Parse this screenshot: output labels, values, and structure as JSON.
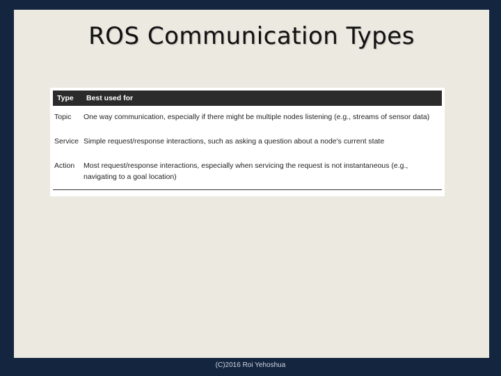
{
  "slide": {
    "title": "ROS Communication Types",
    "footer": "(C)2016 Roi Yehoshua"
  },
  "table": {
    "headers": [
      "Type",
      "Best used for"
    ],
    "rows": [
      {
        "type": "Topic",
        "desc": "One way communication, especially if there might be multiple nodes listening (e.g., streams of sensor data)"
      },
      {
        "type": "Service",
        "desc": "Simple request/response interactions, such as asking a question about a node's current state"
      },
      {
        "type": "Action",
        "desc": "Most request/response interactions, especially when servicing the request is not instantaneous (e.g., navigating to a goal location)"
      }
    ]
  }
}
